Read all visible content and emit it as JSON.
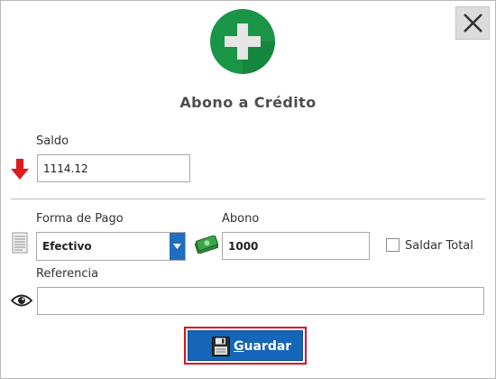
{
  "dialog": {
    "title": "Abono a Crédito"
  },
  "saldo": {
    "label": "Saldo",
    "value": "1114.12"
  },
  "forma_pago": {
    "label": "Forma de Pago",
    "selected": "Efectivo"
  },
  "abono": {
    "label": "Abono",
    "value": "1000"
  },
  "saldar_total": {
    "label": "Saldar Total",
    "checked": false
  },
  "referencia": {
    "label": "Referencia",
    "value": ""
  },
  "save_button": {
    "mnemonic": "G",
    "label_rest": "uardar"
  },
  "icons": {
    "logo": "add-icon",
    "close": "close-icon",
    "saldo": "arrow-down-icon",
    "forma_pago": "document-icon",
    "abono": "money-icon",
    "referencia": "eye-icon",
    "save": "floppy-disk-icon"
  },
  "colors": {
    "accent_green": "#1a9446",
    "button_blue": "#1565b8",
    "focus_red": "#d8121b",
    "arrow_red": "#e01b1b"
  }
}
